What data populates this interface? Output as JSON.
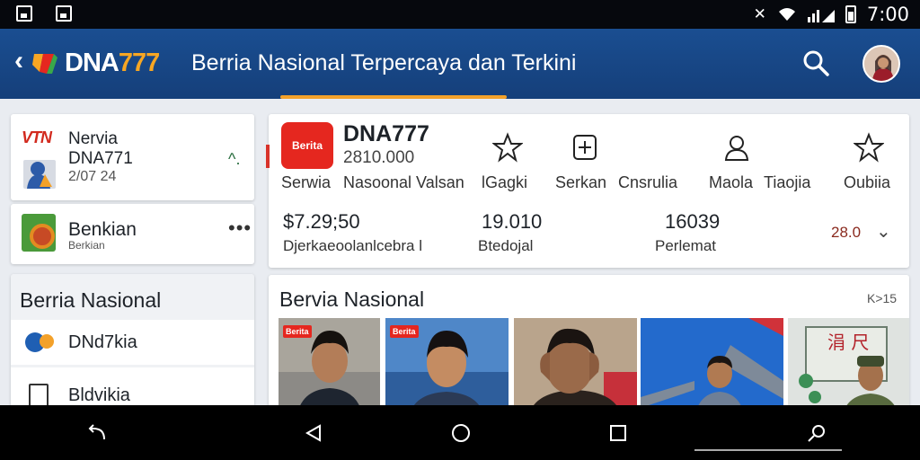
{
  "status_bar": {
    "time": "7:00",
    "icons": [
      "screenshot-icon",
      "image-icon",
      "bluetooth-icon",
      "wifi-icon",
      "signal-icon",
      "battery-icon"
    ]
  },
  "app_bar": {
    "logo": {
      "text_white": "DNA",
      "text_orange": "777"
    },
    "title": "Berria Nasional Terpercaya dan Terkini",
    "accent_color": "#f3a12a",
    "bar_color": "#1a4e91"
  },
  "sidebar": {
    "profile_card": {
      "brand": "VTN",
      "line1": "Nervia",
      "line2": "DNA771",
      "line3": "2/07 24"
    },
    "second_card": {
      "title": "Benkian",
      "subtitle": "Berkian"
    },
    "section": {
      "title": "Berria Nasional",
      "items": [
        {
          "label": "DNd7kia"
        },
        {
          "label": "Bldvikia"
        }
      ]
    }
  },
  "detail": {
    "logo_text": "Berita",
    "name": "DNA777",
    "subtitle": "2810.000",
    "desc1": "Serwia",
    "desc2": "Nasoonal Valsan",
    "actions": [
      {
        "label": "lGagki",
        "icon": "star-icon"
      },
      {
        "label": "Serkan",
        "icon": "add-icon"
      },
      {
        "label": "Cnsrulia",
        "icon": ""
      },
      {
        "label": "Maola",
        "icon": "person-icon"
      },
      {
        "label": "Tiaojia",
        "icon": ""
      },
      {
        "label": "Oubiia",
        "icon": "star-icon"
      }
    ],
    "stats": [
      {
        "value": "$7.29;50",
        "label": "Djerkaeoolanlcebra l"
      },
      {
        "value": "19.010",
        "label": "Btedojal"
      },
      {
        "value": "16039",
        "label": "Perlemat"
      }
    ],
    "extra_value": "28.0"
  },
  "news": {
    "title": "Bervia Nasional",
    "expand_label": "K>15",
    "items": [
      {
        "badge": "Berita"
      },
      {
        "badge": "Berita"
      },
      {
        "badge": ""
      },
      {
        "badge": ""
      },
      {
        "badge": ""
      }
    ]
  }
}
